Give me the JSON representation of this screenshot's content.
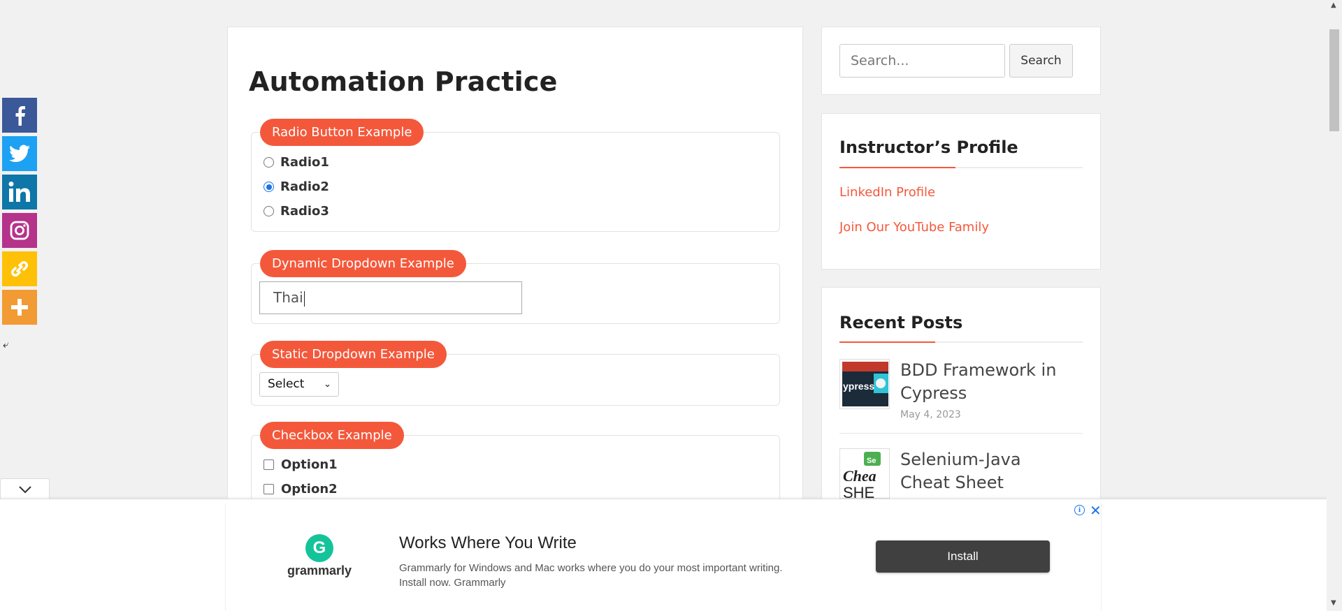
{
  "page": {
    "title": "Automation Practice"
  },
  "radio_section": {
    "legend": "Radio Button Example",
    "options": [
      {
        "label": "Radio1",
        "checked": false
      },
      {
        "label": "Radio2",
        "checked": true
      },
      {
        "label": "Radio3",
        "checked": false
      }
    ]
  },
  "dynamic_dropdown": {
    "legend": "Dynamic Dropdown Example",
    "value": "Thai"
  },
  "static_dropdown": {
    "legend": "Static Dropdown Example",
    "selected": "Select"
  },
  "checkbox_section": {
    "legend": "Checkbox Example",
    "options": [
      "Option1",
      "Option2"
    ]
  },
  "sidebar": {
    "search": {
      "placeholder": "Search...",
      "button_label": "Search"
    },
    "instructor": {
      "title": "Instructor’s Profile",
      "links": [
        "LinkedIn Profile",
        "Join Our YouTube Family"
      ]
    },
    "recent_posts": {
      "title": "Recent Posts",
      "posts": [
        {
          "title": "BDD Framework in Cypress",
          "date": "May 4, 2023",
          "thumb_text": "ypress"
        },
        {
          "title": "Selenium-Java Cheat Sheet",
          "date": "",
          "thumb_text": "Cheat SHE"
        }
      ]
    }
  },
  "share_bar": {
    "items": [
      "facebook-icon",
      "twitter-icon",
      "linkedin-icon",
      "instagram-icon",
      "copy-link-icon",
      "more-icon"
    ]
  },
  "ad": {
    "brand": "grammarly",
    "logo_letter": "G",
    "headline": "Works Where You Write",
    "body": "Grammarly for Windows and Mac works where you do your most important writing. Install now. Grammarly",
    "cta": "Install"
  },
  "colors": {
    "accent": "#f4583b",
    "radio_selected": "#1a73e8",
    "grammarly_green": "#15c39a"
  }
}
